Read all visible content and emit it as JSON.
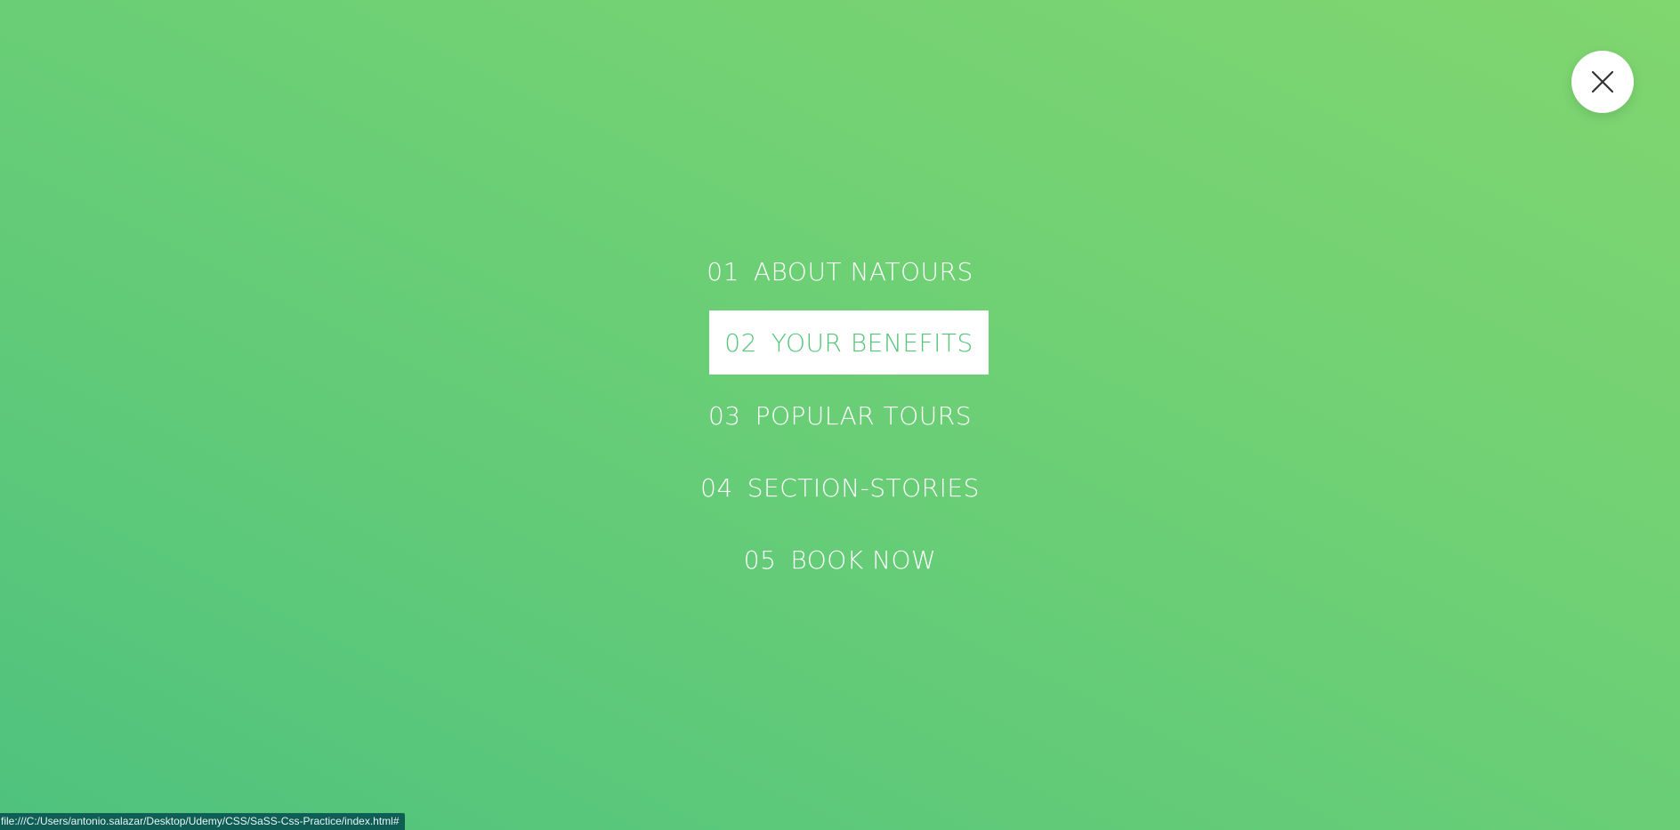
{
  "navigation": {
    "close_icon": "close-x-icon",
    "items": [
      {
        "number": "01",
        "label": "ABOUT NATOURS",
        "active": false
      },
      {
        "number": "02",
        "label": "YOUR BENEFITS",
        "active": true
      },
      {
        "number": "03",
        "label": "POPULAR TOURS",
        "active": false
      },
      {
        "number": "04",
        "label": "SECTION-STORIES",
        "active": false
      },
      {
        "number": "05",
        "label": "BOOK NOW",
        "active": false
      }
    ]
  },
  "status_bar": {
    "url": "file:///C:/Users/antonio.salazar/Desktop/Udemy/CSS/SaSS-Css-Practice/index.html#"
  },
  "colors": {
    "gradient_start": "#4fc27e",
    "gradient_end": "#80d66f",
    "active_text": "#55c57a",
    "status_bar_bg": "#0f5e56"
  }
}
